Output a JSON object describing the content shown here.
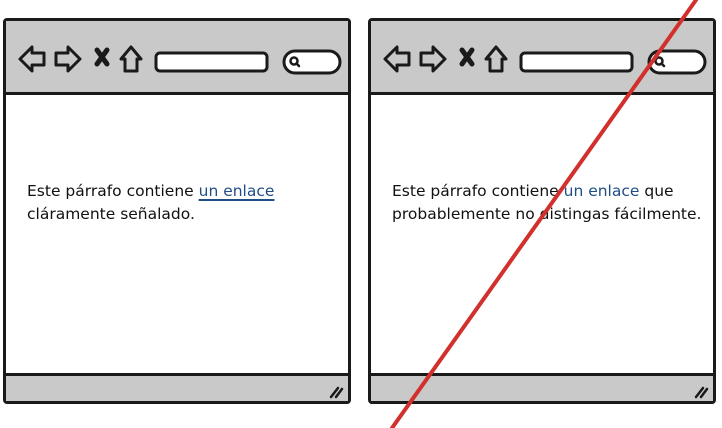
{
  "windows": [
    {
      "paragraph": {
        "before": "Este párrafo contiene ",
        "link": "un enlace",
        "after": " cláramente señalado."
      },
      "link_style": "underlined"
    },
    {
      "paragraph": {
        "before": "Este párrafo contiene ",
        "link": "un enlace",
        "after": " que probablemente no distingas fácilmente."
      },
      "link_style": "plain"
    }
  ],
  "colors": {
    "link": "#1f4e86",
    "toolbar": "#c9c9c9",
    "crossout": "#d2302c"
  },
  "icons": [
    "back-arrow-icon",
    "forward-arrow-icon",
    "close-x-icon",
    "home-icon",
    "search-icon",
    "resize-grip-icon"
  ]
}
